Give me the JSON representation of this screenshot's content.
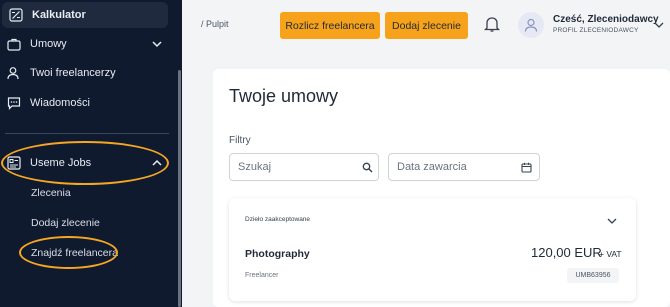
{
  "sidebar": {
    "items": [
      {
        "label": "Kalkulator",
        "icon": "calculator-icon"
      },
      {
        "label": "Umowy",
        "icon": "briefcase-icon"
      },
      {
        "label": "Twoi freelancerzy",
        "icon": "people-icon"
      },
      {
        "label": "Wiadomości",
        "icon": "chat-icon"
      },
      {
        "label": "Useme Jobs",
        "icon": "jobs-card-icon"
      }
    ],
    "sub_items": [
      "Zlecenia",
      "Dodaj zlecenie",
      "Znajdź freelancera"
    ]
  },
  "header": {
    "breadcrumb": "/ Pulpit",
    "settle_button": "Rozlicz freelancera",
    "add_order_button": "Dodaj zlecenie",
    "greeting": "Cześć, Zleceniodawcy",
    "profile": "PROFIL ZLECENIODAWCY"
  },
  "main": {
    "title": "Twoje umowy",
    "filters_label": "Filtry",
    "search_placeholder": "Szukaj",
    "date_placeholder": "Data zawarcia",
    "contract": {
      "status": "Dzieło zaakceptowane",
      "title": "Photography",
      "price": "120,00 EUR",
      "vat": "+ VAT",
      "role": "Freelancer",
      "id": "UMB63956"
    }
  },
  "colors": {
    "sidebar_bg": "#0f1a2e",
    "accent": "#f7a21b",
    "highlight": "#f5a623"
  }
}
